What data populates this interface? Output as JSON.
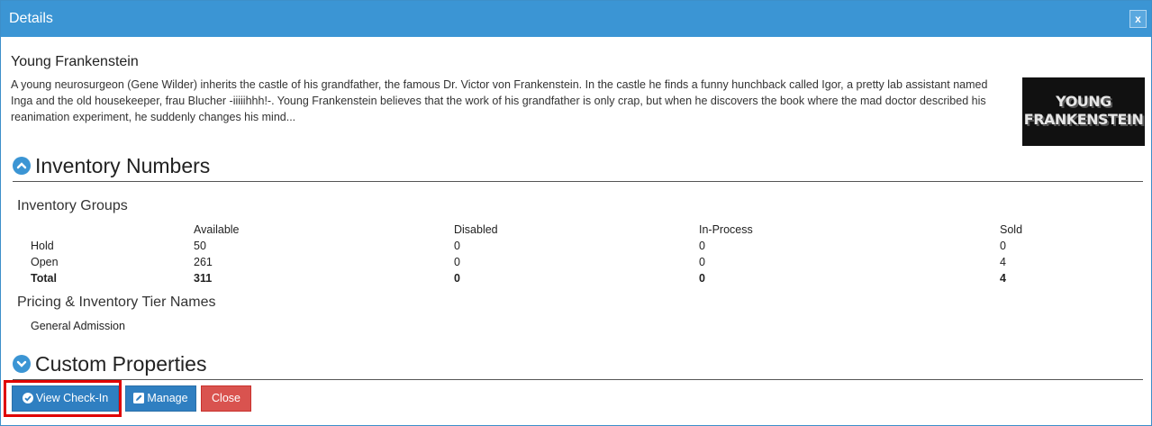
{
  "dialog": {
    "title": "Details",
    "close_label": "x"
  },
  "movie": {
    "title": "Young Frankenstein",
    "description": "A young neurosurgeon (Gene Wilder) inherits the castle of his grandfather, the famous Dr. Victor von Frankenstein. In the castle he finds a funny hunchback called Igor, a pretty lab assistant named Inga and the old housekeeper, frau Blucher -iiiiihhh!-. Young Frankenstein believes that the work of his grandfather is only crap, but when he discovers the book where the mad doctor described his reanimation experiment, he suddenly changes his mind...",
    "poster_line1": "YOUNG",
    "poster_line2": "FRANKENSTEIN"
  },
  "inventory": {
    "section_title": "Inventory Numbers",
    "section_icon": "chevron-up-circle-icon",
    "groups_title": "Inventory Groups",
    "columns": [
      "Available",
      "Disabled",
      "In-Process",
      "Sold"
    ],
    "rows": [
      {
        "label": "Hold",
        "values": [
          "50",
          "0",
          "0",
          "0"
        ]
      },
      {
        "label": "Open",
        "values": [
          "261",
          "0",
          "0",
          "4"
        ]
      },
      {
        "label": "Total",
        "values": [
          "311",
          "0",
          "0",
          "4"
        ]
      }
    ],
    "tiers_title": "Pricing & Inventory Tier Names",
    "tiers": [
      "General Admission"
    ]
  },
  "custom": {
    "section_title": "Custom Properties",
    "section_icon": "chevron-down-circle-icon"
  },
  "buttons": {
    "view_checkin": "View Check-In",
    "manage": "Manage",
    "close": "Close"
  },
  "colors": {
    "titlebar": "#3b95d4",
    "primary_button": "#2f7fc1",
    "danger_button": "#d9534f",
    "highlight": "#e00000"
  }
}
